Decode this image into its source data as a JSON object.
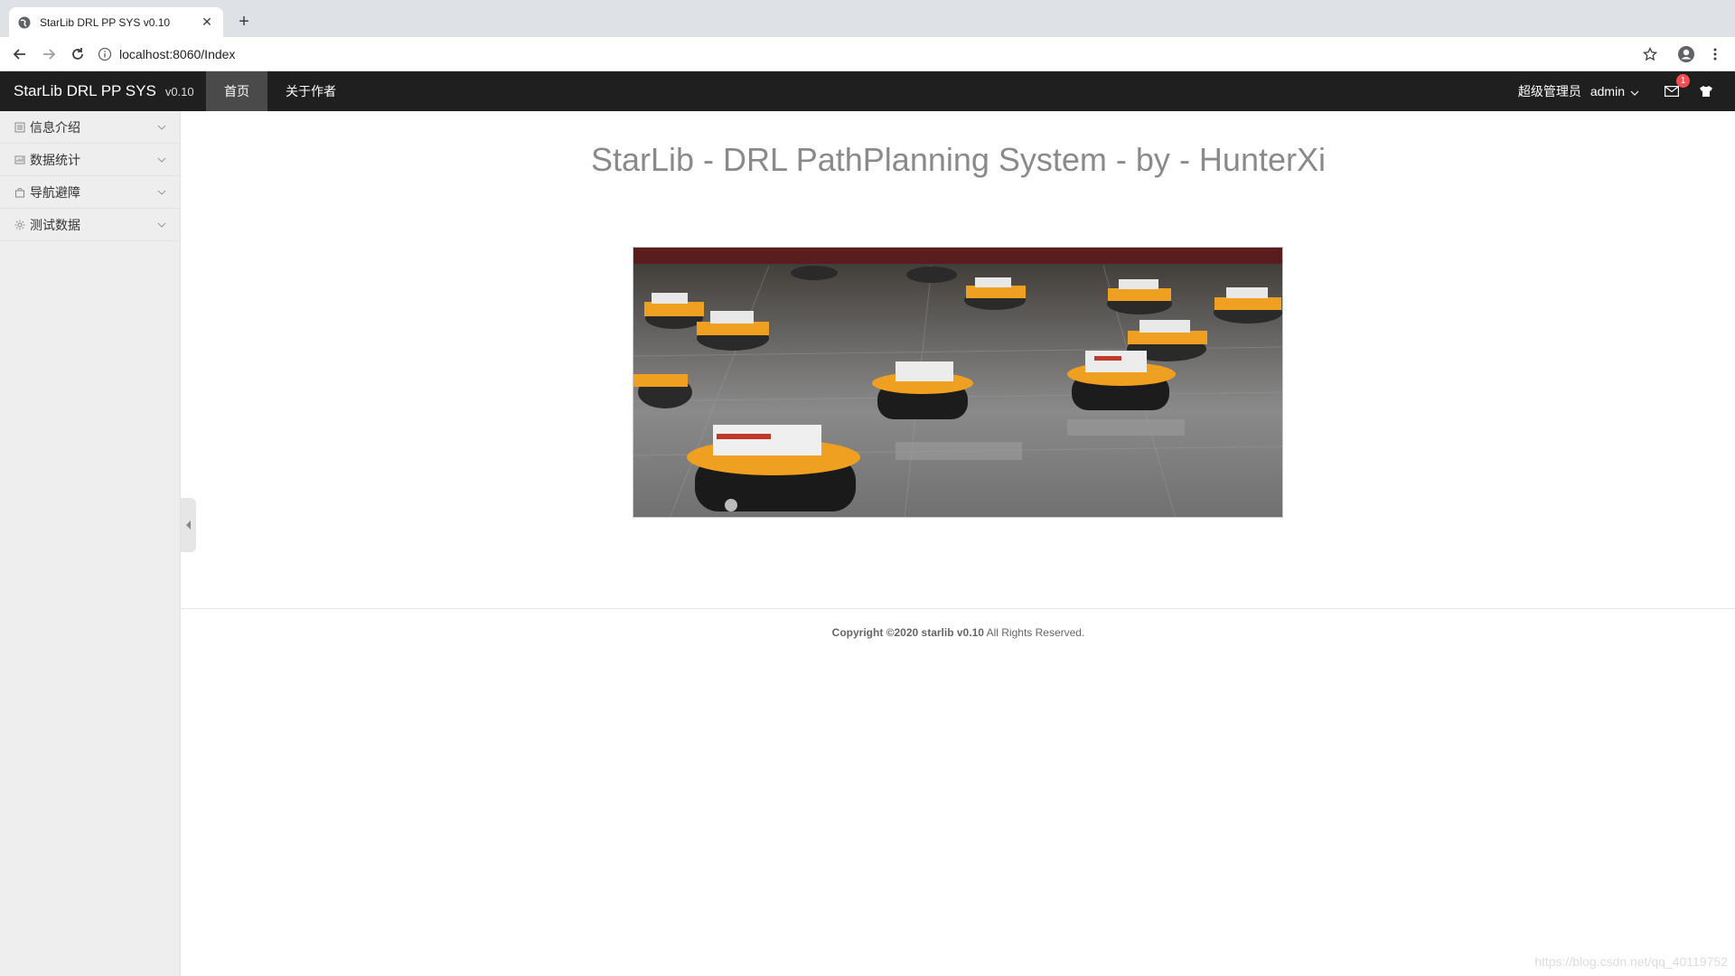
{
  "browser": {
    "tab_title": "StarLib DRL PP SYS v0.10",
    "url": "localhost:8060/Index"
  },
  "header": {
    "brand_name": "StarLib DRL PP SYS",
    "brand_version": "v0.10",
    "nav": [
      {
        "label": "首页",
        "active": true
      },
      {
        "label": "关于作者",
        "active": false
      }
    ],
    "role": "超级管理员",
    "username": "admin",
    "mail_count": "1",
    "accent_color": "#1f1f1f"
  },
  "sidebar": {
    "items": [
      {
        "label": "信息介绍",
        "icon": "document-icon"
      },
      {
        "label": "数据统计",
        "icon": "chart-icon"
      },
      {
        "label": "导航避障",
        "icon": "bag-icon"
      },
      {
        "label": "测试数据",
        "icon": "gear-icon"
      }
    ]
  },
  "main": {
    "title": "StarLib - DRL PathPlanning System - by - HunterXi",
    "footer_strong": "Copyright ©2020 starlib v0.10",
    "footer_rest": " All Rights Reserved."
  },
  "watermark": "https://blog.csdn.net/qq_40119752"
}
